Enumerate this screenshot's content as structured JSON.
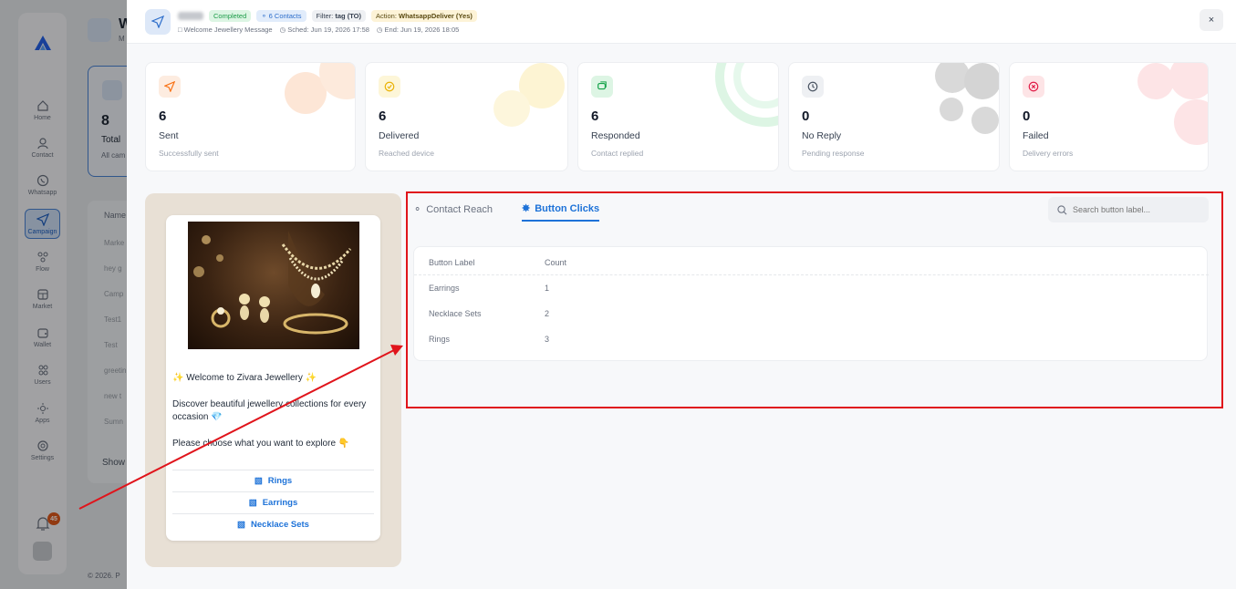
{
  "sidebar": {
    "items": [
      {
        "label": "Home",
        "icon": "home-icon"
      },
      {
        "label": "Contact",
        "icon": "user-icon"
      },
      {
        "label": "Whatsapp",
        "icon": "whatsapp-icon"
      },
      {
        "label": "Campaign",
        "icon": "send-icon"
      },
      {
        "label": "Flow",
        "icon": "flow-icon"
      },
      {
        "label": "Market",
        "icon": "store-icon"
      },
      {
        "label": "Wallet",
        "icon": "wallet-icon"
      },
      {
        "label": "Users",
        "icon": "users-icon"
      },
      {
        "label": "Apps",
        "icon": "apps-icon"
      },
      {
        "label": "Settings",
        "icon": "gear-icon"
      }
    ],
    "active": "Campaign",
    "notification_count": "45"
  },
  "background_page": {
    "title": "W",
    "subtitle": "M",
    "card_value": "8",
    "card_label": "Total",
    "card_sub": "All cam",
    "table_header": "Name",
    "rows": [
      "Marke",
      "hey g",
      "Camp",
      "Test1",
      "Test",
      "greetin",
      "new t",
      "Sumn"
    ],
    "show_label": "Show",
    "footer": "© 2026. P"
  },
  "drawer": {
    "status": "Completed",
    "contacts": "6 Contacts",
    "filter_prefix": "Filter:",
    "filter_value": "tag (TO)",
    "action_prefix": "Action:",
    "action_value": "WhatsappDeliver (Yes)",
    "template": "Welcome Jewellery Message",
    "scheduled": "Sched: Jun 19, 2026 17:58",
    "ended": "End: Jun 19, 2026 18:05",
    "close": "×"
  },
  "stats": [
    {
      "value": "6",
      "label": "Sent",
      "sub": "Successfully sent",
      "color": "#f97316"
    },
    {
      "value": "6",
      "label": "Delivered",
      "sub": "Reached device",
      "color": "#eab308"
    },
    {
      "value": "6",
      "label": "Responded",
      "sub": "Contact replied",
      "color": "#16a34a"
    },
    {
      "value": "0",
      "label": "No Reply",
      "sub": "Pending response",
      "color": "#4b5563"
    },
    {
      "value": "0",
      "label": "Failed",
      "sub": "Delivery errors",
      "color": "#e11d48"
    }
  ],
  "preview": {
    "welcome": "Welcome to Zivara Jewellery",
    "body": "Discover beautiful jewellery collections for every occasion",
    "prompt": "Please choose what you want to explore",
    "buttons": [
      "Rings",
      "Earrings",
      "Necklace Sets"
    ]
  },
  "panel": {
    "tabs": [
      {
        "label": "Contact Reach",
        "active": false
      },
      {
        "label": "Button Clicks",
        "active": true
      }
    ],
    "search_placeholder": "Search button label...",
    "columns": [
      "Button Label",
      "Count"
    ],
    "rows": [
      {
        "label": "Earrings",
        "count": "1"
      },
      {
        "label": "Necklace Sets",
        "count": "2"
      },
      {
        "label": "Rings",
        "count": "3"
      }
    ]
  },
  "colors": {
    "accent": "#1d72d8",
    "annotation": "#e0141b"
  }
}
